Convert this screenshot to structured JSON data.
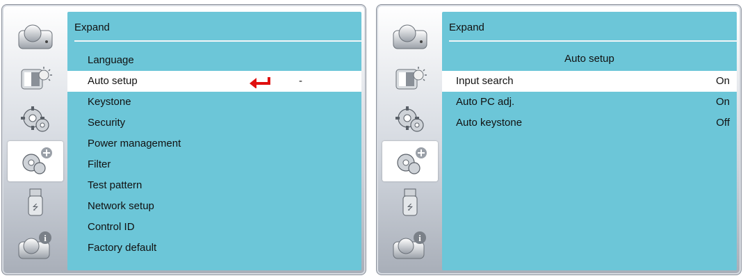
{
  "left_panel": {
    "header": "Expand",
    "items": [
      {
        "label": "Language"
      },
      {
        "label": "Auto setup"
      },
      {
        "label": "Keystone"
      },
      {
        "label": "Security"
      },
      {
        "label": "Power management"
      },
      {
        "label": "Filter"
      },
      {
        "label": "Test pattern"
      },
      {
        "label": "Network setup"
      },
      {
        "label": "Control ID"
      },
      {
        "label": "Factory default"
      }
    ],
    "selected_value": "-"
  },
  "right_panel": {
    "header": "Expand",
    "subtitle": "Auto setup",
    "settings": [
      {
        "label": "Input search",
        "value": "On"
      },
      {
        "label": "Auto PC adj.",
        "value": "On"
      },
      {
        "label": "Auto keystone",
        "value": "Off"
      }
    ]
  },
  "sidebar_icons": [
    "camera-icon",
    "image-adjust-icon",
    "gear-icon",
    "gear-plus-icon",
    "usb-icon",
    "camera-info-icon"
  ],
  "colors": {
    "content_bg": "#6cc6d8",
    "selected_bg": "#ffffff",
    "enter_arrow": "#e01010"
  }
}
